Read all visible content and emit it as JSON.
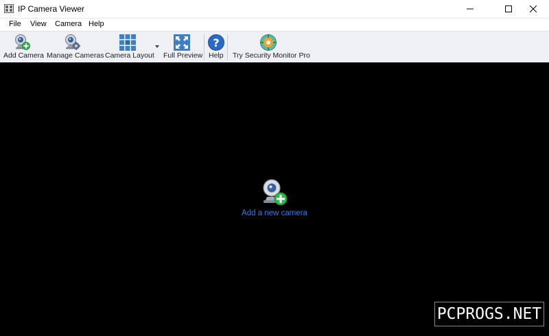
{
  "window": {
    "title": "IP Camera Viewer",
    "controls": [
      "minimize",
      "maximize",
      "close"
    ]
  },
  "menu": {
    "items": [
      "File",
      "View",
      "Camera",
      "Help"
    ]
  },
  "toolbar": {
    "add_camera": "Add Camera",
    "manage_cameras": "Manage Cameras",
    "camera_layout": "Camera Layout",
    "full_preview": "Full Preview",
    "help": "Help",
    "try_pro": "Try Security Monitor Pro"
  },
  "viewport": {
    "add_new_camera": "Add a new camera"
  },
  "watermark": "PCPROGS.NET",
  "colors": {
    "link": "#3a7be0",
    "toolbar_bg": "#eef0f5",
    "viewport_bg": "#000000",
    "plus_green": "#2fb34a"
  },
  "icons": [
    "app-icon",
    "webcam-add-icon",
    "webcam-gear-icon",
    "grid-layout-icon",
    "dropdown-arrow-icon",
    "fullscreen-icon",
    "help-icon",
    "security-pro-icon"
  ]
}
